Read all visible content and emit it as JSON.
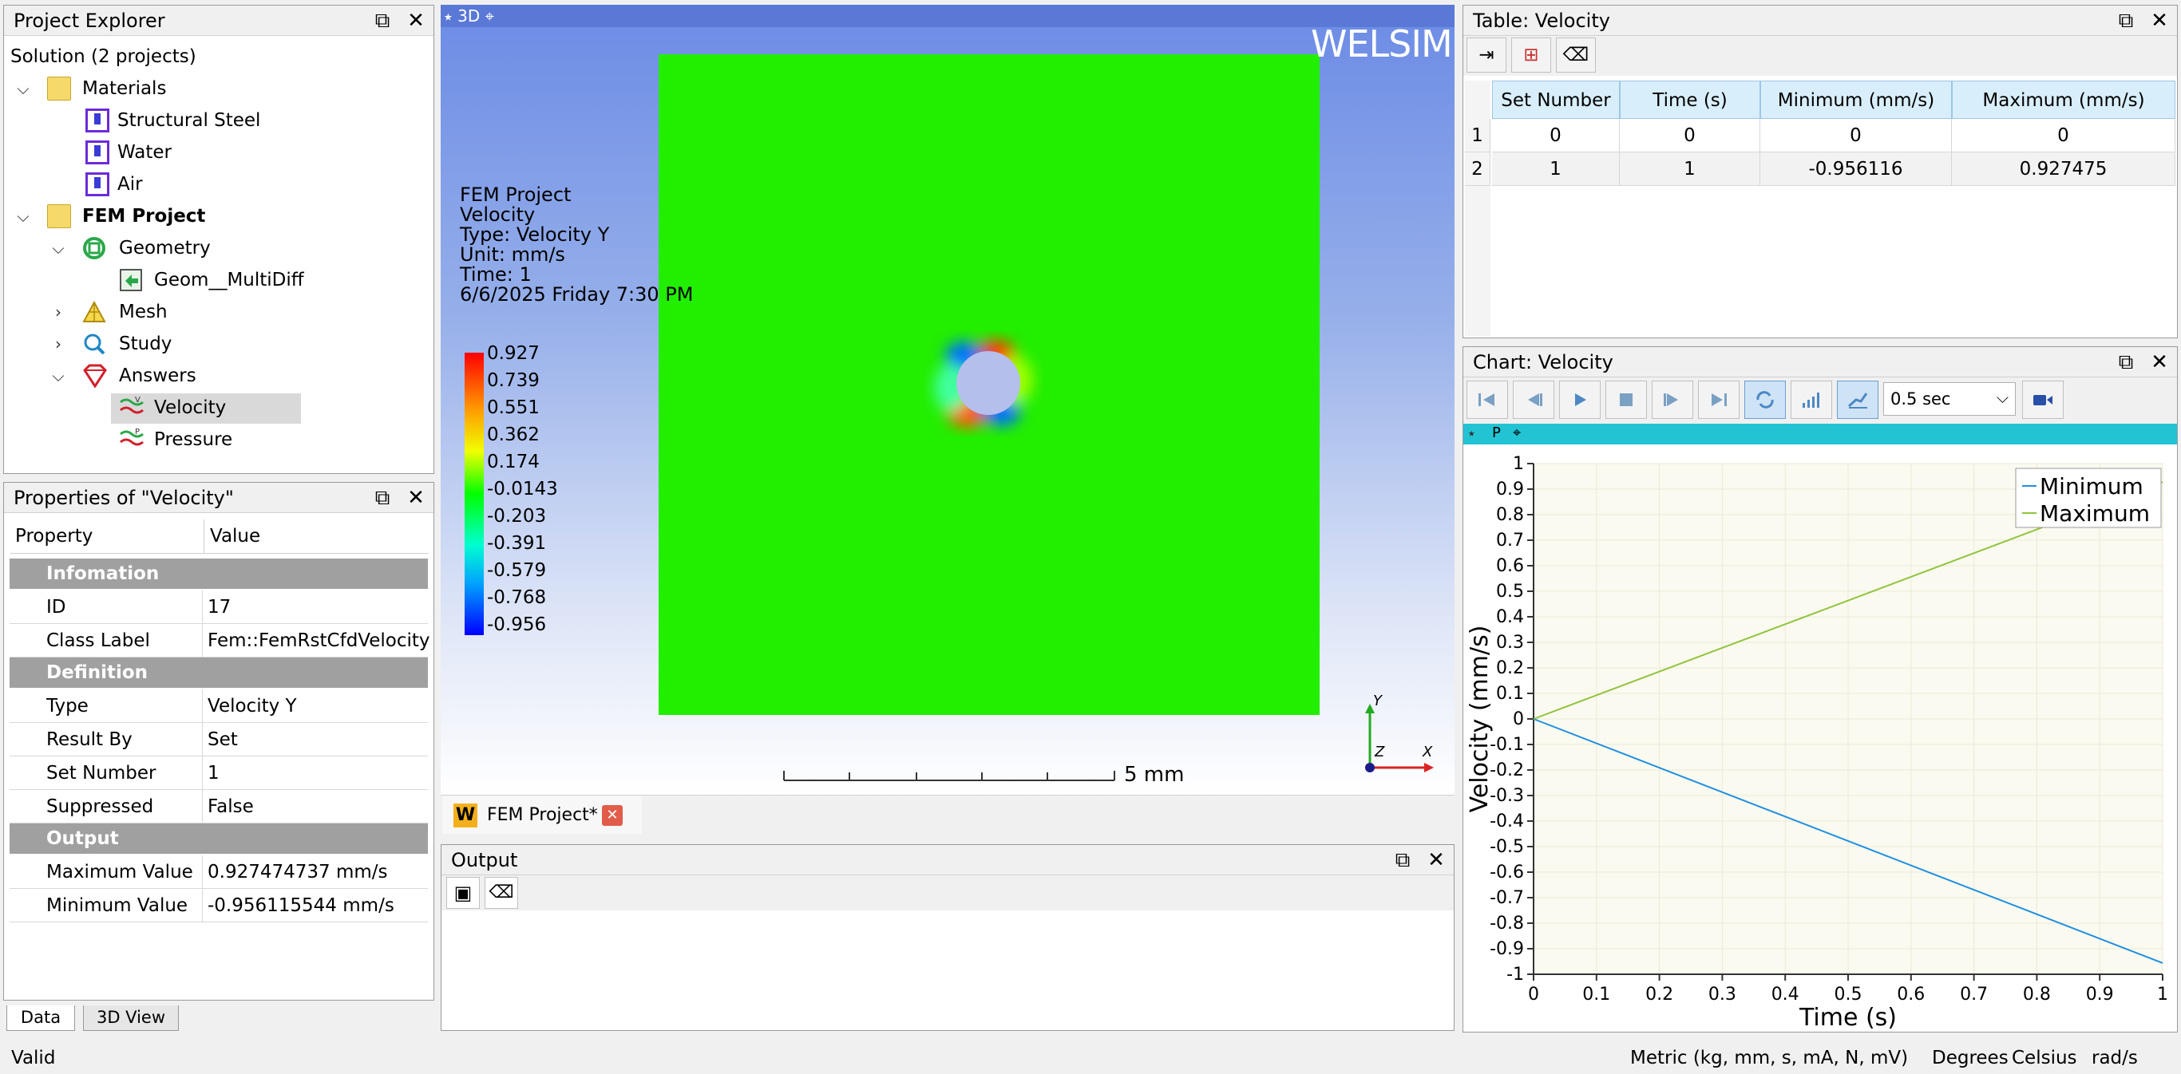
{
  "explorer": {
    "title": "Project Explorer",
    "solution": "Solution (2 projects)",
    "items": [
      {
        "label": "Materials"
      },
      {
        "label": "Structural Steel"
      },
      {
        "label": "Water"
      },
      {
        "label": "Air"
      },
      {
        "label": "FEM Project"
      },
      {
        "label": "Geometry"
      },
      {
        "label": "Geom__MultiDiff"
      },
      {
        "label": "Mesh"
      },
      {
        "label": "Study"
      },
      {
        "label": "Answers"
      },
      {
        "label": "Velocity"
      },
      {
        "label": "Pressure"
      }
    ]
  },
  "properties": {
    "title": "Properties of \"Velocity\"",
    "col_property": "Property",
    "col_value": "Value",
    "sections": {
      "info": "Infomation",
      "definition": "Definition",
      "output": "Output"
    },
    "rows": {
      "id": {
        "name": "ID",
        "value": "17"
      },
      "class": {
        "name": "Class Label",
        "value": "Fem::FemRstCfdVelocity"
      },
      "type": {
        "name": "Type",
        "value": "Velocity Y"
      },
      "result_by": {
        "name": "Result By",
        "value": "Set"
      },
      "set_number": {
        "name": "Set Number",
        "value": "1"
      },
      "suppressed": {
        "name": "Suppressed",
        "value": "False"
      },
      "max": {
        "name": "Maximum Value",
        "value": "0.927474737 mm/s"
      },
      "min": {
        "name": "Minimum Value",
        "value": "-0.956115544 mm/s"
      }
    }
  },
  "left_tabs": [
    "Data",
    "3D View"
  ],
  "viewport": {
    "tab": "3D",
    "brand": "WELSIM",
    "info": [
      "FEM Project",
      "Velocity",
      "Type: Velocity Y",
      "Unit: mm/s",
      "Time: 1",
      "6/6/2025 Friday 7:30 PM"
    ],
    "legend": [
      "0.927",
      "0.739",
      "0.551",
      "0.362",
      "0.174",
      "-0.0143",
      "-0.203",
      "-0.391",
      "-0.579",
      "-0.768",
      "-0.956"
    ],
    "scale_label": "5 mm",
    "axis_y": "Y",
    "axis_x": "X",
    "axis_z": "Z"
  },
  "doc_tab": {
    "label": "FEM Project*",
    "badge": "W"
  },
  "output": {
    "title": "Output"
  },
  "table": {
    "title": "Table: Velocity",
    "headers": [
      "Set Number",
      "Time (s)",
      "Minimum (mm/s)",
      "Maximum (mm/s)"
    ],
    "rows": [
      {
        "idx": "1",
        "cells": [
          "0",
          "0",
          "0",
          "0"
        ]
      },
      {
        "idx": "2",
        "cells": [
          "1",
          "1",
          "-0.956116",
          "0.927475"
        ]
      }
    ]
  },
  "chart_panel": {
    "title": "Chart: Velocity",
    "speed": "0.5 sec",
    "strip_label": "P"
  },
  "chart_data": {
    "type": "line",
    "xlabel": "Time (s)",
    "ylabel": "Velocity (mm/s)",
    "xlim": [
      0,
      1
    ],
    "ylim": [
      -1,
      1
    ],
    "x_ticks": [
      "0",
      "0.1",
      "0.2",
      "0.3",
      "0.4",
      "0.5",
      "0.6",
      "0.7",
      "0.8",
      "0.9",
      "1"
    ],
    "y_ticks": [
      "1",
      "0.9",
      "0.8",
      "0.7",
      "0.6",
      "0.5",
      "0.4",
      "0.3",
      "0.2",
      "0.1",
      "0",
      "-0.1",
      "-0.2",
      "-0.3",
      "-0.4",
      "-0.5",
      "-0.6",
      "-0.7",
      "-0.8",
      "-0.9",
      "-1"
    ],
    "legend_position": "top-right",
    "grid": true,
    "series": [
      {
        "name": "Minimum",
        "color": "#1f8fe0",
        "x": [
          0,
          1
        ],
        "y": [
          0,
          -0.956116
        ]
      },
      {
        "name": "Maximum",
        "color": "#8fc43c",
        "x": [
          0,
          1
        ],
        "y": [
          0,
          0.927475
        ]
      }
    ]
  },
  "status": {
    "left": "Valid",
    "units": "Metric (kg, mm, s, mA, N, mV)",
    "temp": "Degrees",
    "scale": "Celsius",
    "angle": "rad/s"
  }
}
